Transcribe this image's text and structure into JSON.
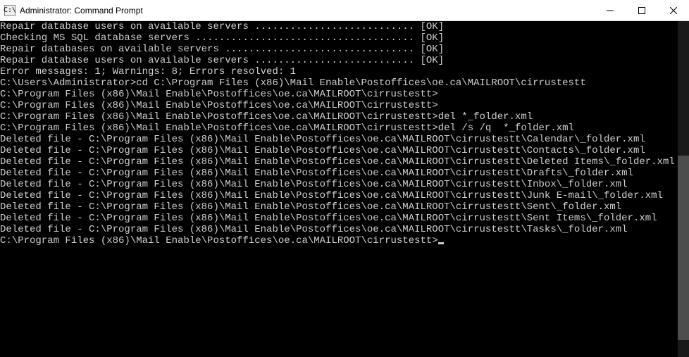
{
  "titlebar": {
    "icon_text": "C:\\",
    "title": "Administrator: Command Prompt"
  },
  "terminal": {
    "lines": [
      "",
      "Repair database users on available servers ........................... [OK]",
      "",
      "Checking MS SQL database servers ..................................... [OK]",
      "",
      "Repair databases on available servers ................................ [OK]",
      "",
      "Repair database users on available servers ........................... [OK]",
      "",
      "Error messages: 1; Warnings: 8; Errors resolved: 1",
      "",
      "",
      "C:\\Users\\Administrator>cd C:\\Program Files (x86)\\Mail Enable\\Postoffices\\oe.ca\\MAILROOT\\cirrustestt",
      "",
      "C:\\Program Files (x86)\\Mail Enable\\Postoffices\\oe.ca\\MAILROOT\\cirrustestt>",
      "C:\\Program Files (x86)\\Mail Enable\\Postoffices\\oe.ca\\MAILROOT\\cirrustestt>",
      "C:\\Program Files (x86)\\Mail Enable\\Postoffices\\oe.ca\\MAILROOT\\cirrustestt>del *_folder.xml",
      "",
      "C:\\Program Files (x86)\\Mail Enable\\Postoffices\\oe.ca\\MAILROOT\\cirrustestt>del /s /q  *_folder.xml",
      "Deleted file - C:\\Program Files (x86)\\Mail Enable\\Postoffices\\oe.ca\\MAILROOT\\cirrustestt\\Calendar\\_folder.xml",
      "Deleted file - C:\\Program Files (x86)\\Mail Enable\\Postoffices\\oe.ca\\MAILROOT\\cirrustestt\\Contacts\\_folder.xml",
      "Deleted file - C:\\Program Files (x86)\\Mail Enable\\Postoffices\\oe.ca\\MAILROOT\\cirrustestt\\Deleted Items\\_folder.xml",
      "Deleted file - C:\\Program Files (x86)\\Mail Enable\\Postoffices\\oe.ca\\MAILROOT\\cirrustestt\\Drafts\\_folder.xml",
      "Deleted file - C:\\Program Files (x86)\\Mail Enable\\Postoffices\\oe.ca\\MAILROOT\\cirrustestt\\Inbox\\_folder.xml",
      "Deleted file - C:\\Program Files (x86)\\Mail Enable\\Postoffices\\oe.ca\\MAILROOT\\cirrustestt\\Junk E-mail\\_folder.xml",
      "Deleted file - C:\\Program Files (x86)\\Mail Enable\\Postoffices\\oe.ca\\MAILROOT\\cirrustestt\\Sent\\_folder.xml",
      "Deleted file - C:\\Program Files (x86)\\Mail Enable\\Postoffices\\oe.ca\\MAILROOT\\cirrustestt\\Sent Items\\_folder.xml",
      "Deleted file - C:\\Program Files (x86)\\Mail Enable\\Postoffices\\oe.ca\\MAILROOT\\cirrustestt\\Tasks\\_folder.xml",
      "",
      "C:\\Program Files (x86)\\Mail Enable\\Postoffices\\oe.ca\\MAILROOT\\cirrustestt>"
    ]
  },
  "scrollbar": {
    "thumb_top_pct": 40,
    "thumb_height_pct": 55
  }
}
